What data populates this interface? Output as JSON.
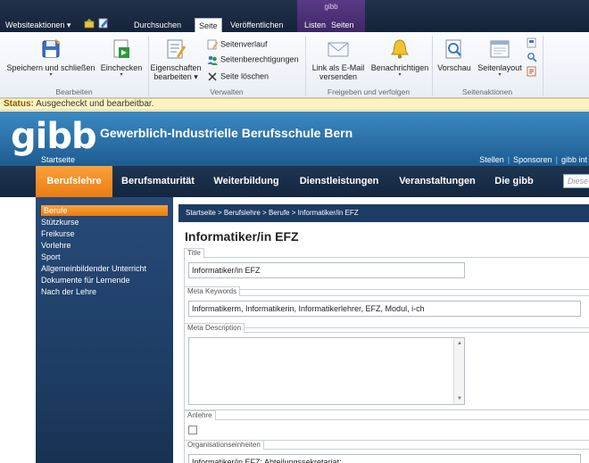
{
  "tabbar": {
    "site_actions": "Websiteaktionen",
    "site_actions_arrow": "▾",
    "context_group": "gibb",
    "tabs": [
      {
        "label": "Durchsuchen"
      },
      {
        "label": "Seite"
      },
      {
        "label": "Veröffentlichen"
      },
      {
        "label": "Listen"
      },
      {
        "label": "Seiten"
      }
    ]
  },
  "ribbon": {
    "save_close": "Speichern und schließen",
    "checkin": "Einchecken",
    "properties_1": "Eigenschaften",
    "properties_2": "bearbeiten",
    "history": "Seitenverlauf",
    "permissions": "Seitenberechtigungen",
    "delete_page": "Seite löschen",
    "email_link_1": "Link als E-Mail",
    "email_link_2": "versenden",
    "notify": "Benachrichtigen",
    "preview": "Vorschau",
    "page_layout": "Seitenlayout",
    "arrow": "▾",
    "groups": {
      "edit": "Bearbeiten",
      "manage": "Verwalten",
      "share": "Freigeben und verfolgen",
      "page_actions": "Seitenaktionen"
    }
  },
  "status": {
    "label": "Status:",
    "text": "Ausgecheckt und bearbeitbar."
  },
  "site": {
    "logo": "gibb",
    "name": "Gewerblich-Industrielle Berufsschule Bern",
    "home": "Startseite",
    "links": [
      "Stellen",
      "Sponsoren",
      "gibb int"
    ],
    "links_sep": "|"
  },
  "nav": {
    "items": [
      {
        "label": "Berufslehre"
      },
      {
        "label": "Berufsmaturität"
      },
      {
        "label": "Weiterbildung"
      },
      {
        "label": "Dienstleistungen"
      },
      {
        "label": "Veranstaltungen"
      },
      {
        "label": "Die gibb"
      }
    ],
    "search_placeholder": "Diese"
  },
  "sidebar": {
    "items": [
      {
        "label": "Berufe"
      },
      {
        "label": "Stützkurse"
      },
      {
        "label": "Freikurse"
      },
      {
        "label": "Vorlehre"
      },
      {
        "label": "Sport"
      },
      {
        "label": "Allgemeinbildender Unterricht"
      },
      {
        "label": "Dokumente für Lernende"
      },
      {
        "label": "Nach der Lehre"
      }
    ]
  },
  "content": {
    "breadcrumb": "Startseite  >  Berufslehre  >  Berufe  >  Informatiker/in EFZ",
    "title": "Informatiker/in EFZ",
    "fields": {
      "title_label": "Title",
      "title_value": "Informatiker/in EFZ",
      "keywords_label": "Meta Keywords",
      "keywords_value": "Informatikerm, Informatikerin, Informatikerlehrer, EFZ, Modul, i-ch",
      "description_label": "Meta Description",
      "scroll_up": "▲",
      "scroll_down": "▼",
      "anlehre_label": "Anlehre",
      "org_label": "Organisationseinheiten",
      "org_value": "Informatiker/in EFZ: Abteilungssekretariat;"
    }
  }
}
